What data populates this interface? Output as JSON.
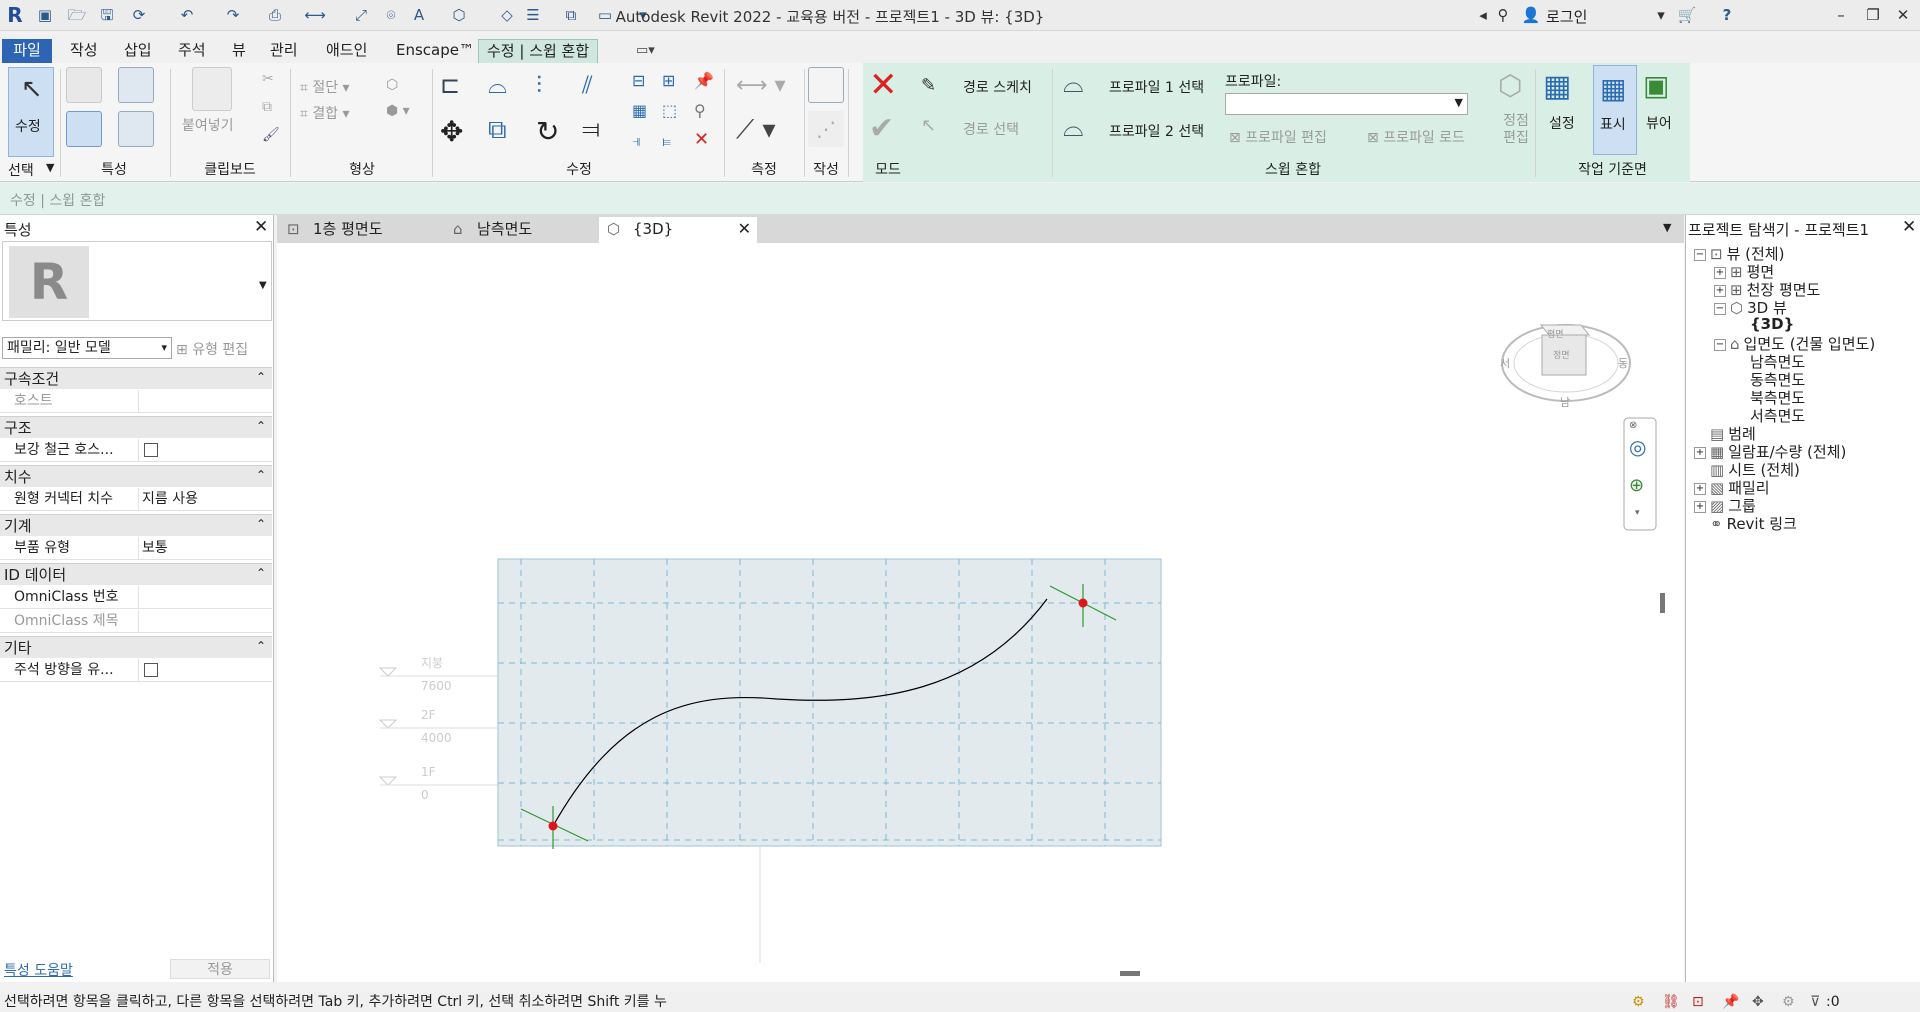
{
  "titlebar": {
    "title": "Autodesk Revit 2022 - 교육용 버전 - 프로젝트1 - 3D 뷰: {3D}",
    "login": "로그인"
  },
  "menu": {
    "tabs": [
      "파일",
      "작성",
      "삽입",
      "주석",
      "뷰",
      "관리",
      "애드인",
      "Enscape™",
      "수정 | 스윕 혼합"
    ]
  },
  "ribbon": {
    "modify_label": "수정",
    "select_label": "선택",
    "panels": {
      "properties": "특성",
      "clipboard": "클립보드",
      "geometry": "형상",
      "modify": "수정",
      "measure": "측정",
      "create": "작성",
      "mode": "모드",
      "sweep_blend": "스윕 혼합",
      "work_plane": "작업 기준면"
    },
    "paste": "붙여넣기",
    "cut": "절단",
    "join": "결합",
    "sketch_path": "경로 스케치",
    "pick_path": "경로 선택",
    "select_profile1": "프로파일 1 선택",
    "select_profile2": "프로파일 2 선택",
    "profile_label": "프로파일:",
    "profile_value": "",
    "edit_profile": "프로파일 편집",
    "load_profile": "프로파일 로드",
    "edit_vertices": "정점\n편집",
    "set": "설정",
    "show": "표시",
    "viewer": "뷰어"
  },
  "optionsbar": {
    "text": "수정 | 스윕 혼합"
  },
  "properties": {
    "title": "특성",
    "family_select": "패밀리: 일반 모델",
    "edit_type": "유형 편집",
    "groups": [
      {
        "name": "구속조건",
        "rows": [
          {
            "k": "호스트",
            "v": "",
            "muted": true
          }
        ]
      },
      {
        "name": "구조",
        "rows": [
          {
            "k": "보강 철근 호스...",
            "v": "checkbox"
          }
        ]
      },
      {
        "name": "치수",
        "rows": [
          {
            "k": "원형 커넥터 치수",
            "v": "지름 사용"
          }
        ]
      },
      {
        "name": "기계",
        "rows": [
          {
            "k": "부품 유형",
            "v": "보통"
          }
        ]
      },
      {
        "name": "ID 데이터",
        "rows": [
          {
            "k": "OmniClass 번호",
            "v": ""
          },
          {
            "k": "OmniClass 제목",
            "v": "",
            "muted": true
          }
        ]
      },
      {
        "name": "기타",
        "rows": [
          {
            "k": "주석 방향을 유...",
            "v": "checkbox"
          }
        ]
      }
    ],
    "help_link": "특성 도움말",
    "apply": "적용"
  },
  "viewtabs": [
    {
      "label": "1층 평면도",
      "active": false
    },
    {
      "label": "남측면도",
      "active": false
    },
    {
      "label": "{3D}",
      "active": true
    }
  ],
  "viewcube": {
    "top": "평면",
    "front": "정면",
    "left": "서",
    "right": "동",
    "bottom": "남"
  },
  "levels": [
    {
      "name": "지붕",
      "elev": "7600"
    },
    {
      "name": "2F",
      "elev": "4000"
    },
    {
      "name": "1F",
      "elev": "0"
    }
  ],
  "browser": {
    "title": "프로젝트 탐색기 - 프로젝트1",
    "nodes": [
      {
        "label": "뷰 (전체)",
        "level": 0,
        "toggle": "−"
      },
      {
        "label": "평면",
        "level": 1,
        "toggle": "+"
      },
      {
        "label": "천장 평면도",
        "level": 1,
        "toggle": "+"
      },
      {
        "label": "3D 뷰",
        "level": 1,
        "toggle": "−"
      },
      {
        "label": "{3D}",
        "level": 2,
        "toggle": ""
      },
      {
        "label": "입면도 (건물 입면도)",
        "level": 1,
        "toggle": "−"
      },
      {
        "label": "남측면도",
        "level": 2,
        "toggle": ""
      },
      {
        "label": "동측면도",
        "level": 2,
        "toggle": ""
      },
      {
        "label": "북측면도",
        "level": 2,
        "toggle": ""
      },
      {
        "label": "서측면도",
        "level": 2,
        "toggle": ""
      },
      {
        "label": "범례",
        "level": 0,
        "toggle": ""
      },
      {
        "label": "일람표/수량 (전체)",
        "level": 0,
        "toggle": "+"
      },
      {
        "label": "시트 (전체)",
        "level": 0,
        "toggle": ""
      },
      {
        "label": "패밀리",
        "level": 0,
        "toggle": "+"
      },
      {
        "label": "그룹",
        "level": 0,
        "toggle": "+"
      },
      {
        "label": "Revit 링크",
        "level": 0,
        "toggle": ""
      }
    ]
  },
  "status": {
    "message": "선택하려면 항목을 클릭하고, 다른 항목을 선택하려면 Tab 키, 추가하려면 Ctrl 키, 선택 취소하려면 Shift 키를 누",
    "filter_count": ":0"
  },
  "colors": {
    "file_tab": "#2e64b4",
    "context_ribbon": "#d9efe6",
    "workplane": "#e3eaee",
    "grid_line": "#7fb8d8",
    "path_curve": "#000000",
    "endpoint": "#e0141b",
    "axis_green": "#2a9a2a"
  }
}
